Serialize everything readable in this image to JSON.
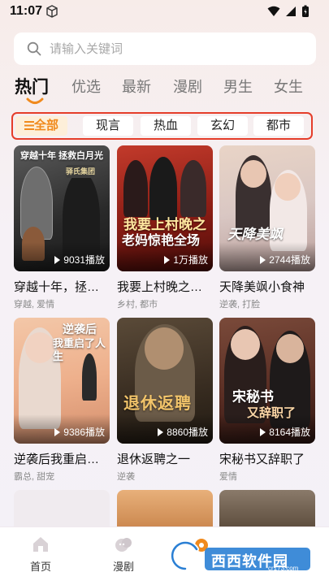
{
  "status": {
    "time": "11:07"
  },
  "search": {
    "placeholder": "请输入关键词"
  },
  "tabs": [
    {
      "label": "热门",
      "active": true
    },
    {
      "label": "优选"
    },
    {
      "label": "最新"
    },
    {
      "label": "漫剧"
    },
    {
      "label": "男生"
    },
    {
      "label": "女生"
    }
  ],
  "filters": [
    {
      "label": "全部",
      "active": true
    },
    {
      "label": "现言"
    },
    {
      "label": "热血"
    },
    {
      "label": "玄幻"
    },
    {
      "label": "都市"
    }
  ],
  "cards": [
    {
      "title": "穿越十年，拯救白月光",
      "tags": "穿越, 爱情",
      "plays": "9031播放",
      "poster_banner": "穿越十年 拯救白月光",
      "poster_title": "",
      "poster_sub": "驿氏集团"
    },
    {
      "title": "我要上村晚之老妈惊艳全场",
      "tags": "乡村, 都市",
      "plays": "1万播放",
      "poster_banner": "",
      "poster_title": "我要上村晚之",
      "poster_sub": "老妈惊艳全场"
    },
    {
      "title": "天降美飒小食神",
      "tags": "逆袭, 打脸",
      "plays": "2744播放",
      "poster_banner": "",
      "poster_title": "天降美飒",
      "poster_sub": ""
    },
    {
      "title": "逆袭后我重启人生",
      "tags": "霸总, 甜宠",
      "plays": "9386播放",
      "poster_banner": "",
      "poster_title": "逆袭后",
      "poster_sub": "我重启了人生"
    },
    {
      "title": "退休返聘之一",
      "tags": "逆袭",
      "plays": "8860播放",
      "poster_banner": "",
      "poster_title": "退休返聘",
      "poster_sub": ""
    },
    {
      "title": "宋秘书又辞职了",
      "tags": "爱情",
      "plays": "8164播放",
      "poster_banner": "",
      "poster_title": "宋秘书",
      "poster_sub": "又辞职了"
    }
  ],
  "bottom_nav": [
    {
      "label": "首页",
      "icon": "home-icon"
    },
    {
      "label": "漫剧",
      "icon": "comic-icon"
    }
  ],
  "watermark": {
    "text": "西西软件园",
    "url": "cr173.com"
  },
  "colors": {
    "accent": "#f08a1d",
    "highlight_border": "#e53d2a"
  }
}
